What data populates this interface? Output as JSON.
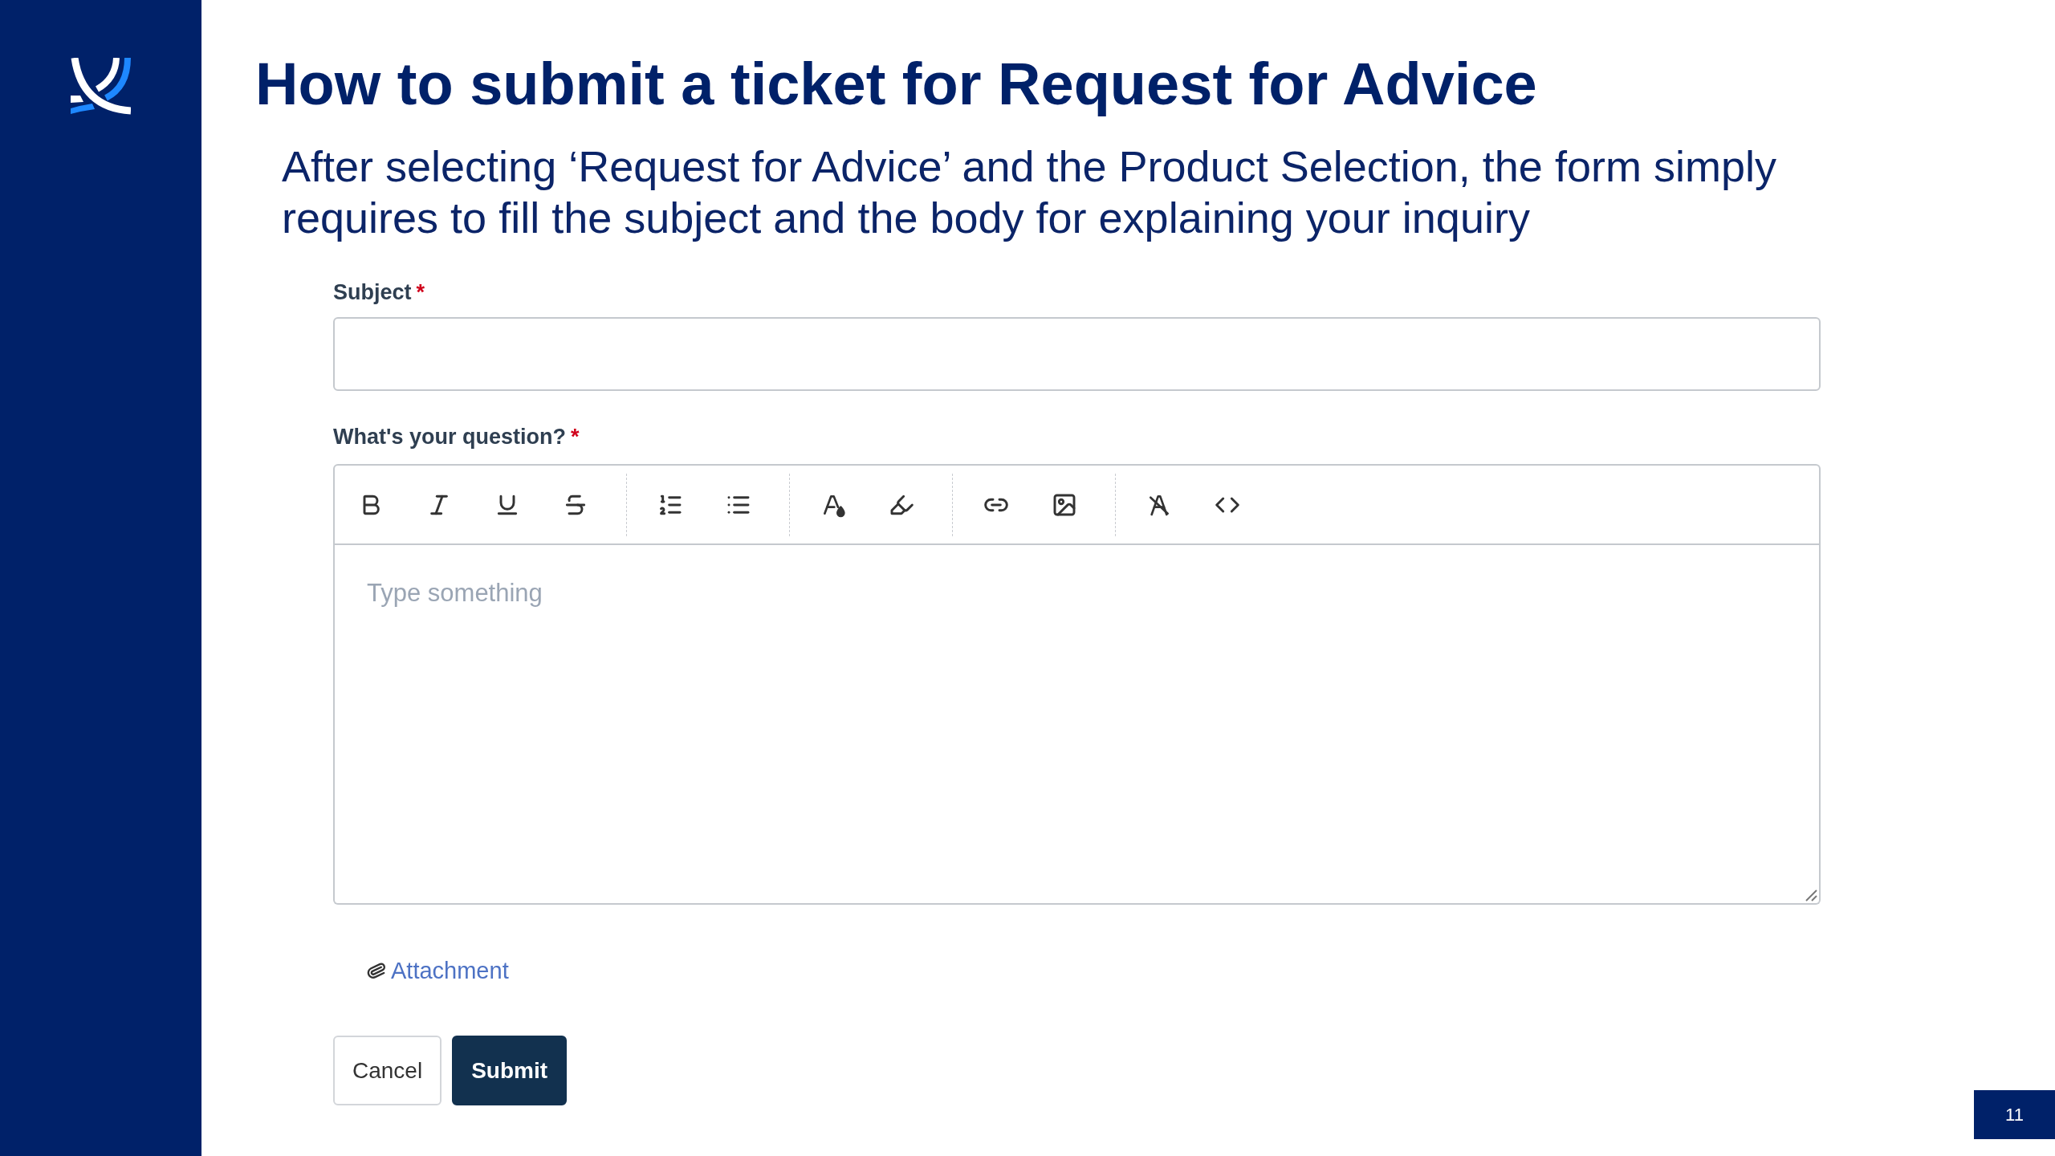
{
  "slide": {
    "title": "How to submit a ticket for Request for Advice",
    "subtitle": "After selecting ‘Request for Advice’ and the Product Selection, the form simply requires to fill the subject and the body for explaining your inquiry"
  },
  "form": {
    "fields": [
      {
        "kind": "input",
        "label": "Subject",
        "required_mark": "*"
      },
      {
        "kind": "rich_text",
        "label": "What's your question?",
        "required_mark": "*",
        "placeholder": "Type something"
      }
    ],
    "attachment_link": "Attachment",
    "buttons": [
      {
        "label": "Cancel",
        "kind": "secondary"
      },
      {
        "label": "Submit",
        "kind": "primary"
      }
    ]
  },
  "page_number": "11"
}
